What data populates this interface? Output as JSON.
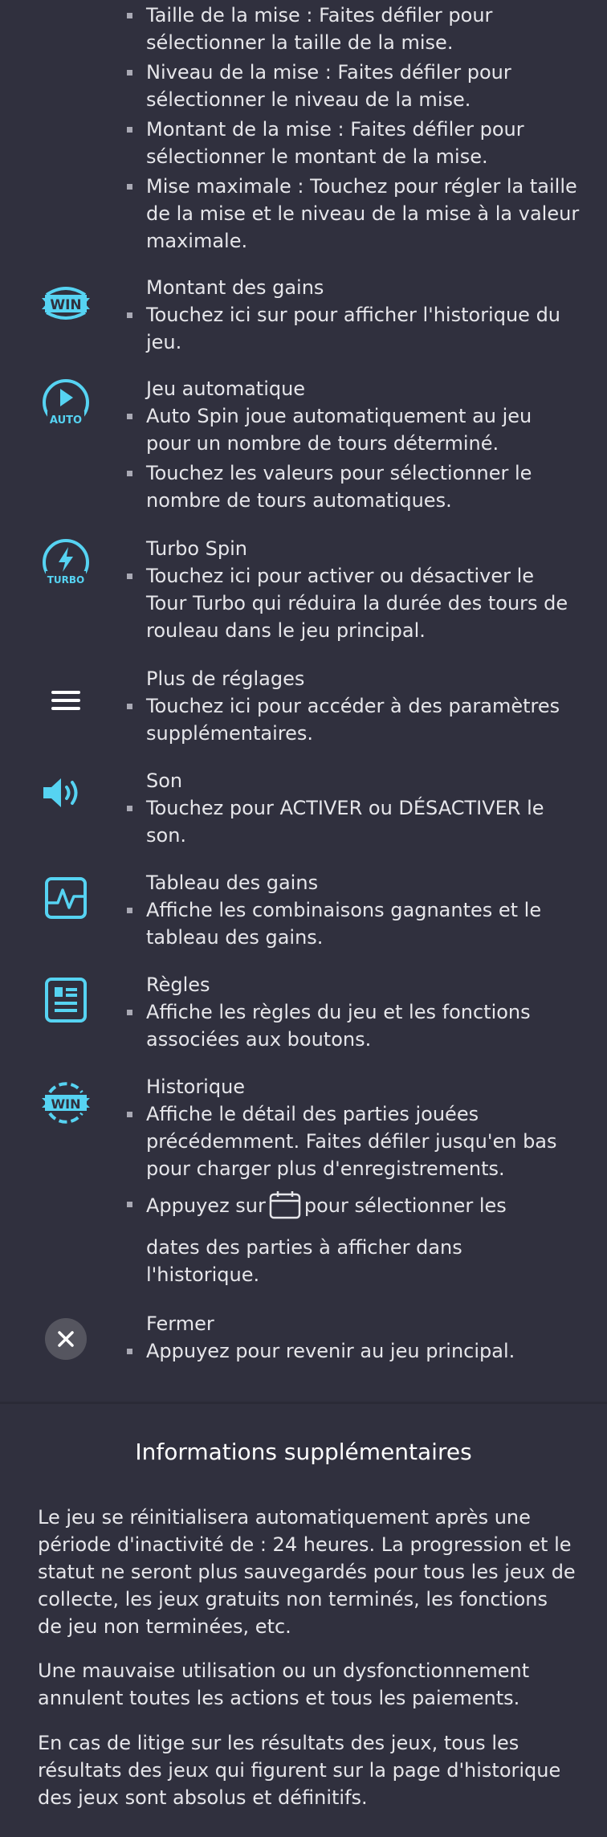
{
  "bet_section": {
    "items": [
      "Taille de la mise : Faites défiler pour sélectionner la taille de la mise.",
      "Niveau de la mise : Faites défiler pour sélectionner le niveau de la mise.",
      "Montant de la mise : Faites défiler pour sélectionner le montant de la mise.",
      "Mise maximale : Touchez pour régler la taille de la mise et le niveau de la mise à la valeur maximale."
    ]
  },
  "sections": {
    "win": {
      "title": "Montant des gains",
      "items": [
        "Touchez ici sur pour afficher l'historique du jeu."
      ],
      "icon": "win-icon",
      "icon_text": "WIN"
    },
    "auto": {
      "title": "Jeu automatique",
      "items": [
        "Auto Spin joue automatiquement au jeu pour un nombre de tours déterminé.",
        "Touchez les valeurs pour sélectionner le nombre de tours automatiques."
      ],
      "icon": "auto-play-icon",
      "icon_text": "AUTO"
    },
    "turbo": {
      "title": "Turbo Spin",
      "items": [
        "Touchez ici pour activer ou désactiver le Tour Turbo qui réduira la durée des tours de rouleau dans le jeu principal."
      ],
      "icon": "turbo-icon",
      "icon_text": "TURBO"
    },
    "settings": {
      "title": "Plus de réglages",
      "items": [
        "Touchez ici pour accéder à des paramètres supplémentaires."
      ],
      "icon": "menu-icon"
    },
    "sound": {
      "title": "Son",
      "items": [
        "Touchez pour ACTIVER ou DÉSACTIVER le son."
      ],
      "icon": "speaker-icon"
    },
    "paytable": {
      "title": "Tableau des gains",
      "items": [
        "Affiche les combinaisons gagnantes et le tableau des gains."
      ],
      "icon": "paytable-icon"
    },
    "rules": {
      "title": "Règles",
      "items": [
        "Affiche les règles du jeu et les fonctions associées aux boutons."
      ],
      "icon": "rules-icon"
    },
    "history": {
      "title": "Historique",
      "items": [
        "Affiche le détail des parties jouées précédemment. Faites défiler jusqu'en bas pour charger plus d'enregistrements."
      ],
      "calendar_before": "Appuyez sur",
      "calendar_after": "pour sélectionner les",
      "calendar_rest": "dates des parties à afficher dans l'historique.",
      "icon": "history-icon",
      "icon_text": "WIN"
    },
    "close": {
      "title": "Fermer",
      "items": [
        "Appuyez pour revenir au jeu principal."
      ],
      "icon": "close-icon"
    }
  },
  "info": {
    "title": "Informations supplémentaires",
    "paragraphs": [
      "Le jeu se réinitialisera automatiquement après une période d'inactivité de : 24 heures. La progression et le statut ne seront plus sauvegardés pour tous les jeux de collecte, les jeux gratuits non terminés, les fonctions de jeu non terminées, etc.",
      "Une mauvaise utilisation ou un dysfonctionnement annulent toutes les actions et tous les paiements.",
      "En cas de litige sur les résultats des jeux, tous les résultats des jeux qui figurent sur la page d'historique des jeux sont absolus et définitifs."
    ]
  },
  "colors": {
    "background": "#30303e",
    "text": "#e6e6ea",
    "accent": "#56d3f2",
    "white": "#ffffff"
  }
}
